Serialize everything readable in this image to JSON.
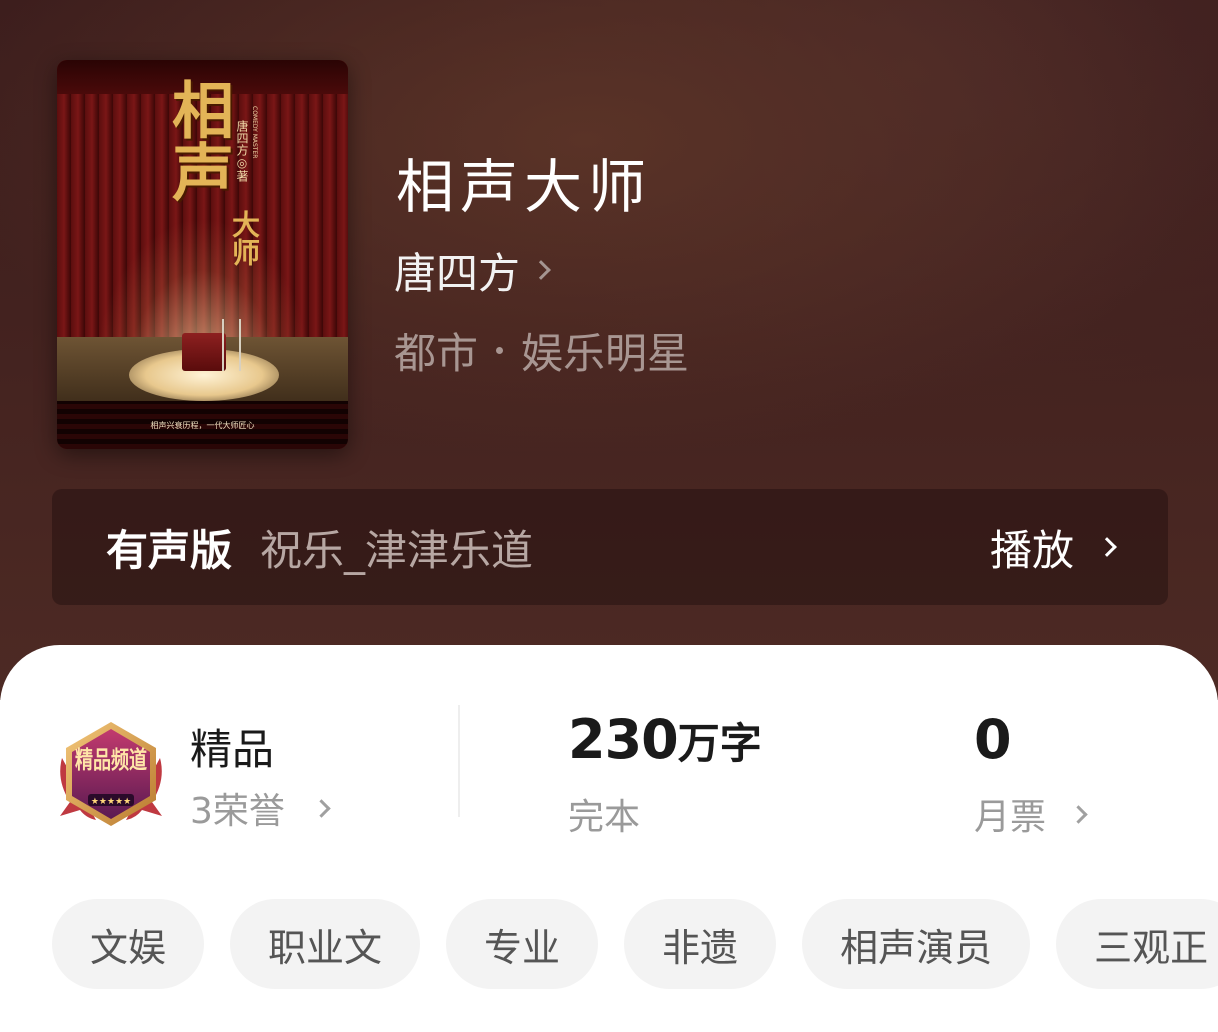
{
  "book": {
    "title": "相声大师",
    "author": "唐四方",
    "category": "都市",
    "subcategory": "娱乐明星",
    "cover": {
      "title": "相声",
      "subtitle": "大师",
      "author_line": "唐四方◎著",
      "english": "COMEDY MASTER",
      "tagline": "相声兴衰历程，一代大师匠心"
    }
  },
  "audio": {
    "label": "有声版",
    "narrator": "祝乐_津津乐道",
    "play_label": "播放"
  },
  "stats": {
    "badge_text": "精品频道",
    "quality_label": "精品",
    "honors": "3荣誉",
    "word_count_number": "230",
    "word_count_unit": "万字",
    "status": "完本",
    "monthly_votes": "0",
    "monthly_votes_label": "月票"
  },
  "tags": [
    "文娱",
    "职业文",
    "专业",
    "非遗",
    "相声演员",
    "三观正"
  ],
  "colors": {
    "header_bg": "#43221f",
    "cover_gold": "#e3b457",
    "muted_text": "#9a9a9a",
    "tag_bg": "#f3f3f3"
  }
}
